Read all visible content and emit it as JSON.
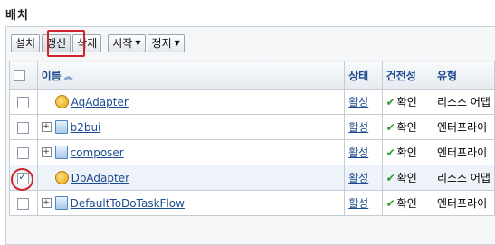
{
  "section_title": "배치",
  "toolbar": {
    "install": "설치",
    "refresh": "갱신",
    "delete": "삭제",
    "start": "시작",
    "stop": "정지"
  },
  "table": {
    "headers": {
      "name": "이름",
      "state": "상태",
      "health": "건전성",
      "type": "유형"
    },
    "rows": [
      {
        "name": "AqAdapter",
        "state": "활성",
        "health": "확인",
        "type": "리소스 어댑",
        "icon": "adapter-icon",
        "expandable": false,
        "checked": false
      },
      {
        "name": "b2bui",
        "state": "활성",
        "health": "확인",
        "type": "엔터프라이",
        "icon": "component-icon",
        "expandable": true,
        "checked": false
      },
      {
        "name": "composer",
        "state": "활성",
        "health": "확인",
        "type": "엔터프라이",
        "icon": "component-icon",
        "expandable": true,
        "checked": false
      },
      {
        "name": "DbAdapter",
        "state": "활성",
        "health": "확인",
        "type": "리소스 어댑",
        "icon": "adapter-icon",
        "expandable": false,
        "checked": true
      },
      {
        "name": "DefaultToDoTaskFlow",
        "state": "활성",
        "health": "확인",
        "type": "엔터프라이",
        "icon": "component-icon",
        "expandable": true,
        "checked": false
      }
    ]
  },
  "colors": {
    "highlight": "#d2232a",
    "link": "#1d4b8f",
    "ok": "#2c9b2c"
  }
}
